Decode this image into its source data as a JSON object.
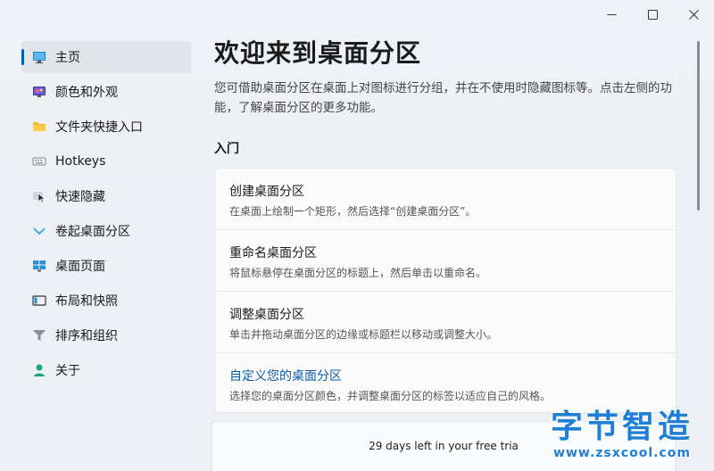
{
  "caption": {
    "minimize_icon": "minimize-icon",
    "maximize_icon": "maximize-icon",
    "close_icon": "close-icon"
  },
  "sidebar": {
    "items": [
      {
        "label": "主页",
        "icon": "home-monitor-icon",
        "active": true
      },
      {
        "label": "颜色和外观",
        "icon": "palette-monitor-icon"
      },
      {
        "label": "文件夹快捷入口",
        "icon": "folder-icon"
      },
      {
        "label": "Hotkeys",
        "icon": "keyboard-icon"
      },
      {
        "label": "快速隐藏",
        "icon": "hide-cursor-icon"
      },
      {
        "label": "卷起桌面分区",
        "icon": "chevron-down-icon"
      },
      {
        "label": "桌面页面",
        "icon": "grid-monitor-icon"
      },
      {
        "label": "布局和快照",
        "icon": "layout-icon"
      },
      {
        "label": "排序和组织",
        "icon": "filter-icon"
      },
      {
        "label": "关于",
        "icon": "person-icon"
      }
    ]
  },
  "main": {
    "title": "欢迎来到桌面分区",
    "description": "您可借助桌面分区在桌面上对图标进行分组，并在不使用时隐藏图标等。点击左侧的功能，了解桌面分区的更多功能。",
    "section_title": "入门",
    "cards": [
      {
        "title": "创建桌面分区",
        "desc": "在桌面上绘制一个矩形，然后选择“创建桌面分区”。"
      },
      {
        "title": "重命名桌面分区",
        "desc": "将鼠标悬停在桌面分区的标题上，然后单击以重命名。"
      },
      {
        "title": "调整桌面分区",
        "desc": "单击并拖动桌面分区的边缘或标题栏以移动或调整大小。"
      },
      {
        "title": "自定义您的桌面分区",
        "desc": "选择您的桌面分区颜色，并调整桌面分区的标签以适应自己的风格。",
        "link": true
      }
    ]
  },
  "trial": {
    "text": "29 days left in your free tria"
  },
  "watermark": {
    "title": "字节智造",
    "url": "www.zsxcool.com"
  },
  "colors": {
    "accent": "#005fb8",
    "link": "#0b5aa6",
    "watermark": "#1f7fd6"
  }
}
